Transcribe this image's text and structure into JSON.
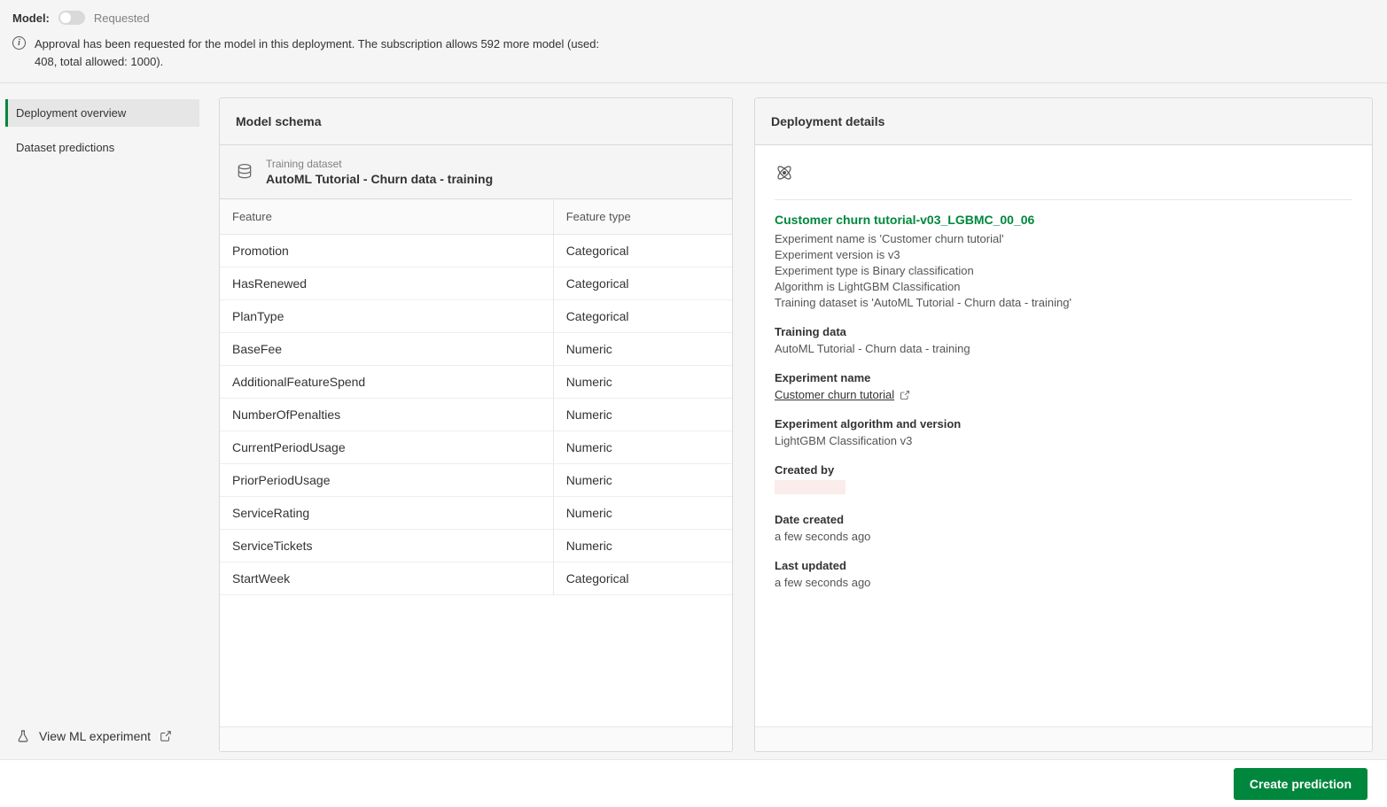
{
  "topbar": {
    "model_label": "Model:",
    "status_text": "Requested",
    "approval_msg": "Approval has been requested for the model in this deployment. The subscription allows 592 more model (used: 408, total allowed: 1000)."
  },
  "sidebar": {
    "items": [
      {
        "label": "Deployment overview",
        "active": true
      },
      {
        "label": "Dataset predictions",
        "active": false
      }
    ],
    "view_experiment": "View ML experiment"
  },
  "schema_panel": {
    "title": "Model schema",
    "dataset_label": "Training dataset",
    "dataset_name": "AutoML Tutorial - Churn data - training",
    "columns": {
      "feature": "Feature",
      "type": "Feature type"
    },
    "rows": [
      {
        "feature": "Promotion",
        "type": "Categorical"
      },
      {
        "feature": "HasRenewed",
        "type": "Categorical"
      },
      {
        "feature": "PlanType",
        "type": "Categorical"
      },
      {
        "feature": "BaseFee",
        "type": "Numeric"
      },
      {
        "feature": "AdditionalFeatureSpend",
        "type": "Numeric"
      },
      {
        "feature": "NumberOfPenalties",
        "type": "Numeric"
      },
      {
        "feature": "CurrentPeriodUsage",
        "type": "Numeric"
      },
      {
        "feature": "PriorPeriodUsage",
        "type": "Numeric"
      },
      {
        "feature": "ServiceRating",
        "type": "Numeric"
      },
      {
        "feature": "ServiceTickets",
        "type": "Numeric"
      },
      {
        "feature": "StartWeek",
        "type": "Categorical"
      }
    ]
  },
  "details_panel": {
    "title": "Deployment details",
    "model_name": "Customer churn tutorial-v03_LGBMC_00_06",
    "meta_lines": [
      "Experiment name is 'Customer churn tutorial'",
      "Experiment version is v3",
      "Experiment type is Binary classification",
      "Algorithm is LightGBM Classification",
      "Training dataset is 'AutoML Tutorial - Churn data - training'"
    ],
    "training_data_label": "Training data",
    "training_data_value": "AutoML Tutorial - Churn data - training",
    "experiment_name_label": "Experiment name",
    "experiment_name_value": "Customer churn tutorial",
    "algo_label": "Experiment algorithm and version",
    "algo_value": "LightGBM Classification v3",
    "created_by_label": "Created by",
    "date_created_label": "Date created",
    "date_created_value": "a few seconds ago",
    "last_updated_label": "Last updated",
    "last_updated_value": "a few seconds ago"
  },
  "footer": {
    "create_prediction": "Create prediction"
  }
}
